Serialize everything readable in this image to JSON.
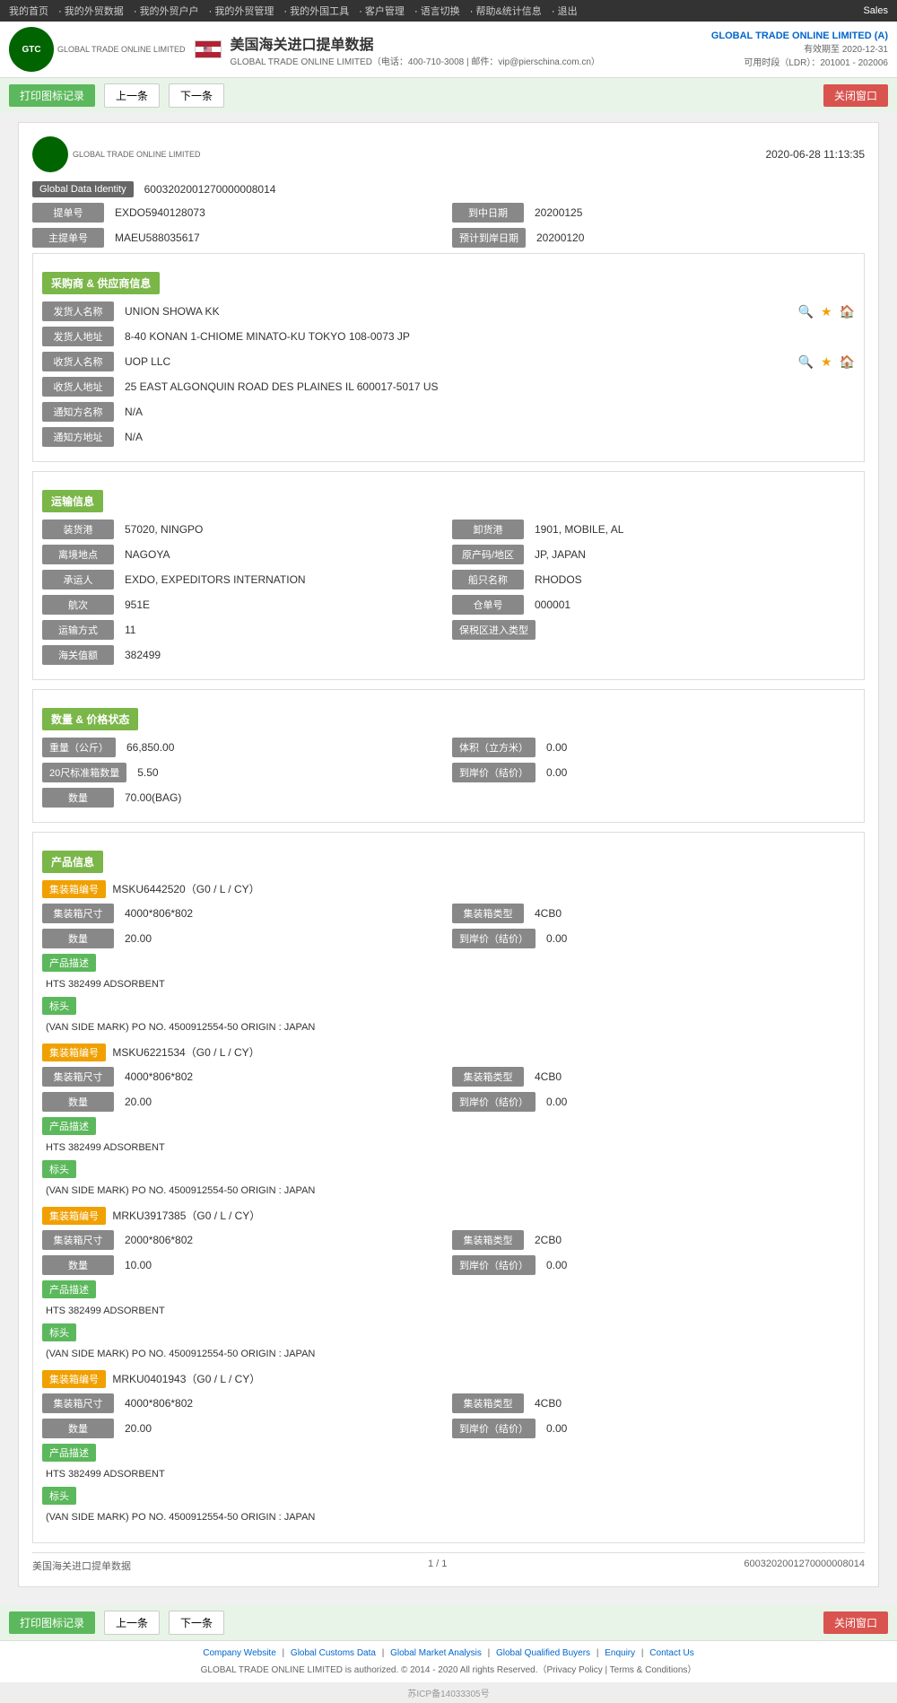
{
  "nav": {
    "items": [
      {
        "label": "我的首页"
      },
      {
        "label": "我的外贸数据"
      },
      {
        "label": "我的外贸户户"
      },
      {
        "label": "我的外贸管理"
      },
      {
        "label": "我的外国工具"
      },
      {
        "label": "客户管理"
      },
      {
        "label": "语言切换"
      },
      {
        "label": "帮助&统计信息"
      },
      {
        "label": "退出"
      }
    ],
    "sales": "Sales"
  },
  "header": {
    "title": "美国海关进口提单数据",
    "company_line": "GLOBAL TRADE ONLINE LIMITED（电话：400-710-3008 | 邮件：vip@pierschina.com.cn）",
    "right_company": "GLOBAL TRADE ONLINE LIMITED (A)",
    "valid_date": "有效期至 2020-12-31",
    "available": "可用时段（LDR）：201001 - 202006"
  },
  "toolbar": {
    "print_label": "打印图标记录",
    "prev_label": "上一条",
    "next_label": "下一条",
    "close_label": "关闭窗口"
  },
  "record": {
    "datetime": "2020-06-28  11:13:35",
    "global_data_identity_label": "Global Data Identity",
    "global_data_identity_value": "6003202001270000008014",
    "bill_no_label": "提单号",
    "bill_no_value": "EXDO5940128073",
    "arrival_date_label": "到中日期",
    "arrival_date_value": "20200125",
    "master_bill_label": "主提单号",
    "master_bill_value": "MAEU588035617",
    "planned_arrival_label": "预计到岸日期",
    "planned_arrival_value": "20200120"
  },
  "shipper_section": {
    "header": "采购商 & 供应商信息",
    "shipper_name_label": "发货人名称",
    "shipper_name_value": "UNION SHOWA KK",
    "shipper_addr_label": "发货人地址",
    "shipper_addr_value": "8-40 KONAN 1-CHIOME MINATO-KU TOKYO 108-0073 JP",
    "consignee_name_label": "收货人名称",
    "consignee_name_value": "UOP LLC",
    "consignee_addr_label": "收货人地址",
    "consignee_addr_value": "25 EAST ALGONQUIN ROAD DES PLAINES IL 600017-5017 US",
    "notify_name_label": "通知方名称",
    "notify_name_value": "N/A",
    "notify_addr_label": "通知方地址",
    "notify_addr_value": "N/A"
  },
  "transport_section": {
    "header": "运输信息",
    "loading_port_label": "装货港",
    "loading_port_value": "57020, NINGPO",
    "discharge_port_label": "卸货港",
    "discharge_port_value": "1901, MOBILE, AL",
    "departure_label": "离境地点",
    "departure_value": "NAGOYA",
    "origin_country_label": "原产码/地区",
    "origin_country_value": "JP, JAPAN",
    "forwarder_label": "承运人",
    "forwarder_value": "EXDO, EXPEDITORS INTERNATION",
    "vessel_name_label": "船只名称",
    "vessel_name_value": "RHODOS",
    "voyage_label": "航次",
    "voyage_value": "951E",
    "bl_no_label": "仓单号",
    "bl_no_value": "000001",
    "transport_mode_label": "运输方式",
    "transport_mode_value": "11",
    "customs_zone_label": "保税区进入类型",
    "customs_zone_value": "",
    "customs_value_label": "海关值额",
    "customs_value_value": "382499"
  },
  "quantity_section": {
    "header": "数量 & 价格状态",
    "weight_label": "重量（公斤）",
    "weight_value": "66,850.00",
    "volume_label": "体积（立方米）",
    "volume_value": "0.00",
    "container20_label": "20尺标准箱数量",
    "container20_value": "5.50",
    "unit_price_label": "到岸价（结价）",
    "unit_price_value": "0.00",
    "quantity_label": "数量",
    "quantity_value": "70.00(BAG)"
  },
  "product_section": {
    "header": "产品信息",
    "containers": [
      {
        "container_no_label": "集装箱编号",
        "container_no_badge": "集装箱编号",
        "container_no_value": "MSKU6442520（G0 / L / CY）",
        "size_label": "集装箱尺寸",
        "size_value": "4000*806*802",
        "type_label": "集装箱类型",
        "type_value": "4CB0",
        "qty_label": "数量",
        "qty_value": "20.00",
        "price_label": "到岸价（结价）",
        "price_value": "0.00",
        "desc_label": "产品描述",
        "desc_value": "HTS 382499 ADSORBENT",
        "mark_label": "标头",
        "mark_value": "(VAN SIDE MARK) PO NO. 4500912554-50 ORIGIN : JAPAN"
      },
      {
        "container_no_label": "集装箱编号",
        "container_no_badge": "集装箱编号",
        "container_no_value": "MSKU6221534（G0 / L / CY）",
        "size_label": "集装箱尺寸",
        "size_value": "4000*806*802",
        "type_label": "集装箱类型",
        "type_value": "4CB0",
        "qty_label": "数量",
        "qty_value": "20.00",
        "price_label": "到岸价（结价）",
        "price_value": "0.00",
        "desc_label": "产品描述",
        "desc_value": "HTS 382499 ADSORBENT",
        "mark_label": "标头",
        "mark_value": "(VAN SIDE MARK) PO NO. 4500912554-50 ORIGIN : JAPAN"
      },
      {
        "container_no_label": "集装箱编号",
        "container_no_badge": "集装箱编号",
        "container_no_value": "MRKU3917385（G0 / L / CY）",
        "size_label": "集装箱尺寸",
        "size_value": "2000*806*802",
        "type_label": "集装箱类型",
        "type_value": "2CB0",
        "qty_label": "数量",
        "qty_value": "10.00",
        "price_label": "到岸价（结价）",
        "price_value": "0.00",
        "desc_label": "产品描述",
        "desc_value": "HTS 382499 ADSORBENT",
        "mark_label": "标头",
        "mark_value": "(VAN SIDE MARK) PO NO. 4500912554-50 ORIGIN : JAPAN"
      },
      {
        "container_no_label": "集装箱编号",
        "container_no_badge": "集装箱编号",
        "container_no_value": "MRKU0401943（G0 / L / CY）",
        "size_label": "集装箱尺寸",
        "size_value": "4000*806*802",
        "type_label": "集装箱类型",
        "type_value": "4CB0",
        "qty_label": "数量",
        "qty_value": "20.00",
        "price_label": "到岸价（结价）",
        "price_value": "0.00",
        "desc_label": "产品描述",
        "desc_value": "HTS 382499 ADSORBENT",
        "mark_label": "标头",
        "mark_value": "(VAN SIDE MARK) PO NO. 4500912554-50 ORIGIN : JAPAN"
      }
    ]
  },
  "card_footer": {
    "left_label": "美国海关进口提单数据",
    "page": "1 / 1",
    "record_id": "6003202001270000008014"
  },
  "footer": {
    "links": [
      "Company Website",
      "Global Customs Data",
      "Global Market Analysis",
      "Global Qualified Buyers",
      "Enquiry",
      "Contact Us"
    ],
    "copyright": "GLOBAL TRADE ONLINE LIMITED is authorized. © 2014 - 2020 All rights Reserved.（Privacy Policy | Terms & Conditions）",
    "icp": "苏ICP备14033305号"
  }
}
